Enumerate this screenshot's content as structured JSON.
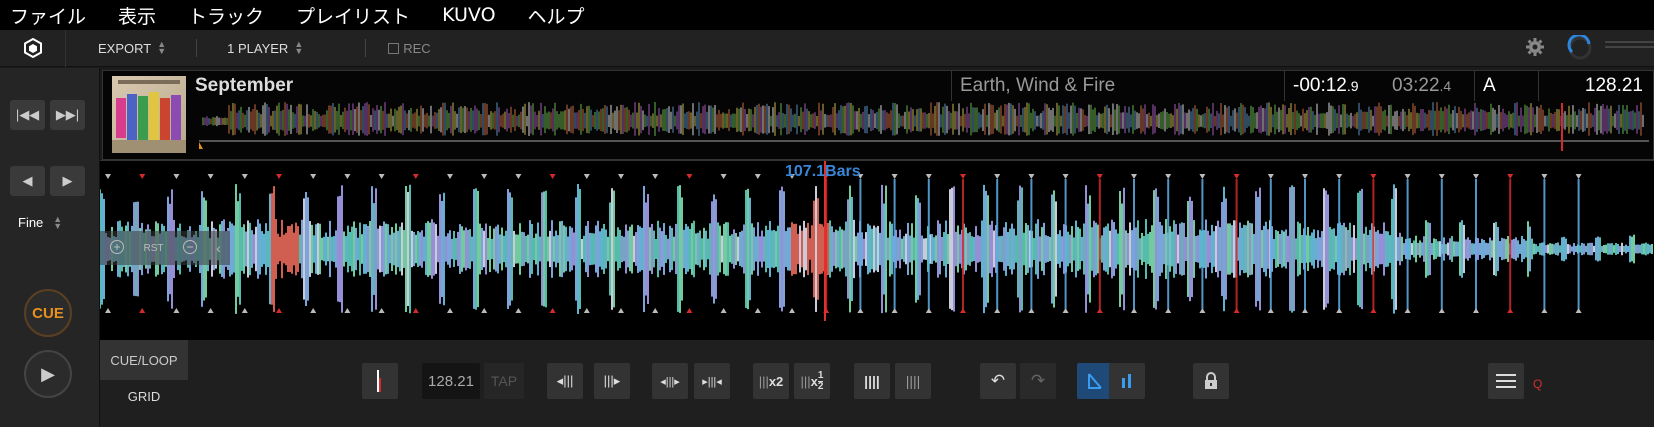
{
  "menu": {
    "file": "ファイル",
    "view": "表示",
    "track": "トラック",
    "playlist": "プレイリスト",
    "kuvo": "KUVO",
    "help": "ヘルプ"
  },
  "toolbar": {
    "export_label": "EXPORT",
    "player_label": "1 PLAYER",
    "rec_label": "REC"
  },
  "left_panel": {
    "fine_label": "Fine",
    "cue_label": "CUE"
  },
  "track": {
    "title": "September",
    "artist": "Earth, Wind & Fire",
    "remaining_main": "-00:12",
    "remaining_fraction": ".9",
    "elapsed_main": "03:22",
    "elapsed_fraction": ".4",
    "key": "A",
    "bpm": "128.21",
    "playhead_position": 0.94
  },
  "zoom_waveform": {
    "bars_label": "107.1Bars",
    "zoom_reset_label": "RST"
  },
  "bottom": {
    "tab_cue_loop": "CUE/LOOP",
    "tab_grid": "GRID",
    "bpm_value": "128.21",
    "tap_label": "TAP",
    "x2_label": "x2",
    "x_half_label": "x",
    "half_num": "1",
    "half_den": "2",
    "q_label": "Q"
  },
  "colors": {
    "accent_blue": "#3a86d6",
    "cue_orange": "#e8901f",
    "marker_red": "#d42a2a"
  }
}
